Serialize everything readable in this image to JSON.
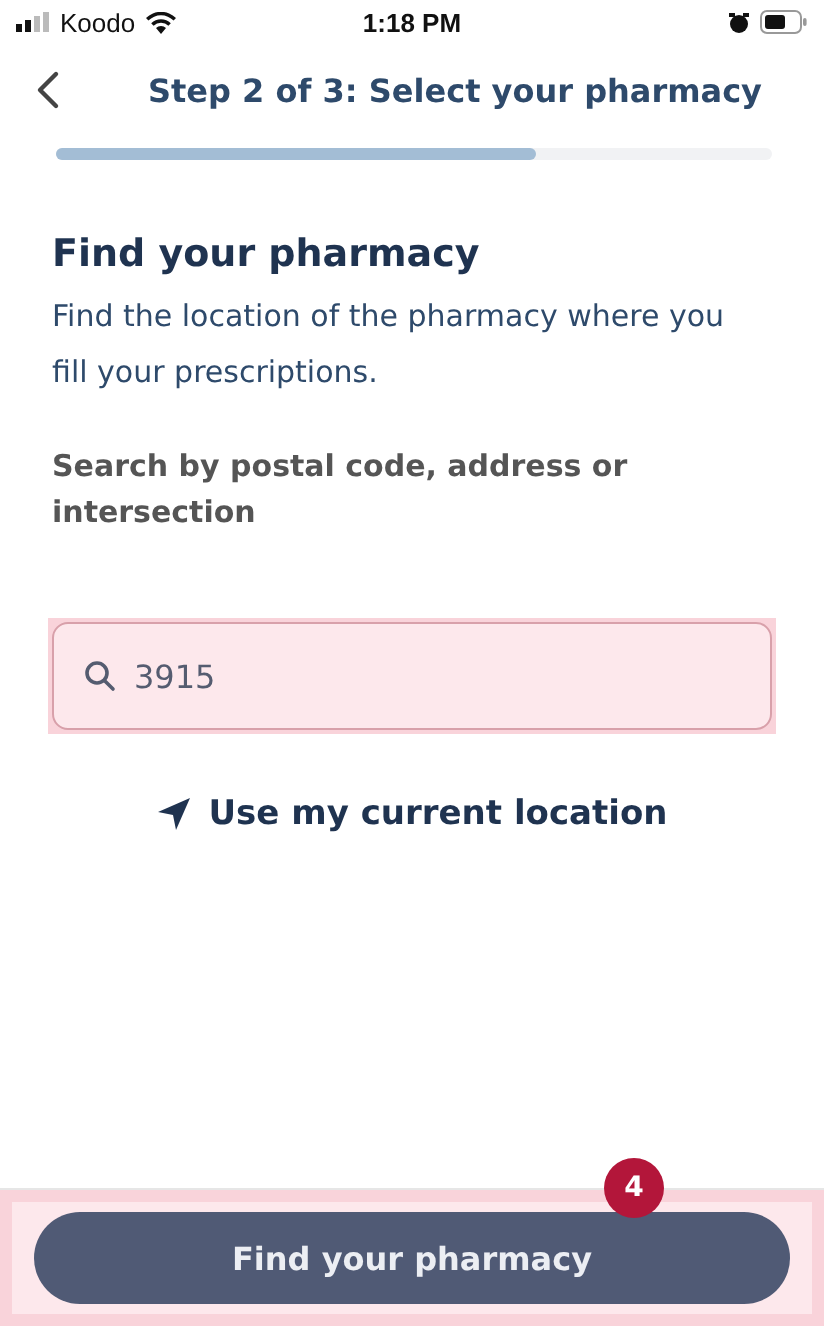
{
  "status_bar": {
    "carrier": "Koodo",
    "time": "1:18 PM"
  },
  "header": {
    "title": "Step 2 of 3: Select your pharmacy"
  },
  "progress": {
    "level": 0.67
  },
  "heading": "Find your pharmacy",
  "description": "Find the location of the pharmacy where you fill your prescriptions.",
  "search_label": "Search by postal code, address or intersection",
  "search": {
    "value": "3915",
    "highlighted": true
  },
  "location_link": "Use my current location",
  "footer": {
    "button": "Find your pharmacy",
    "badge": "4",
    "highlighted": true
  }
}
